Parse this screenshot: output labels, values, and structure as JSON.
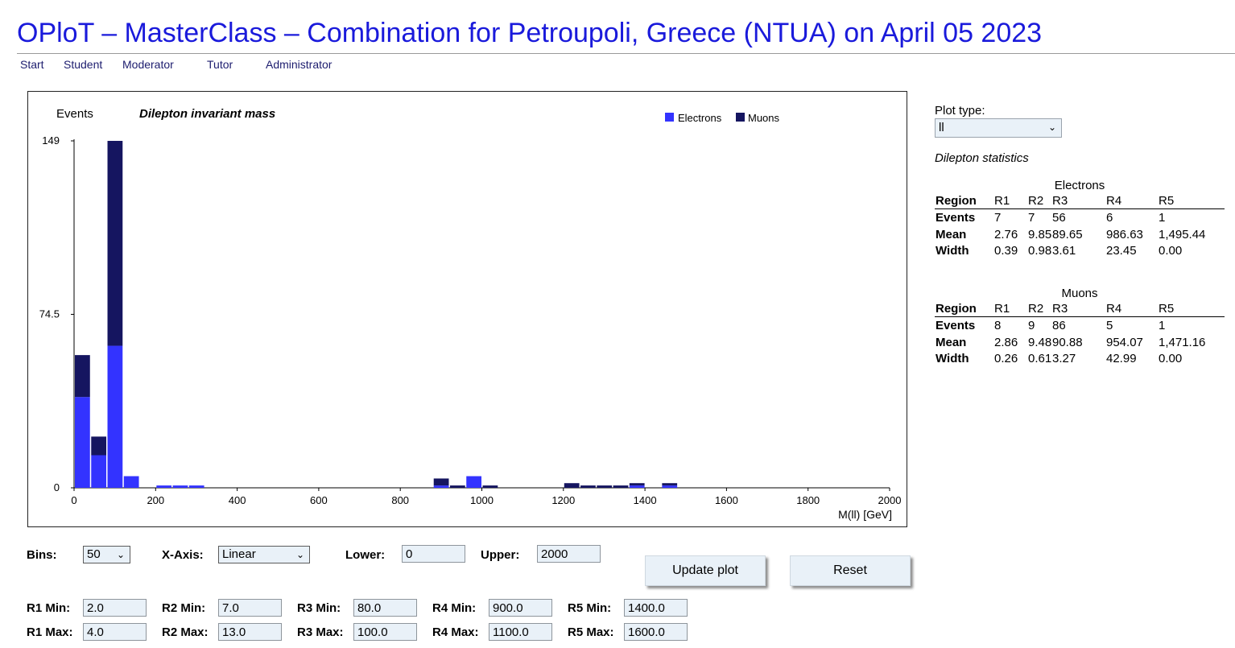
{
  "header": {
    "title": "OPloT – MasterClass – Combination for Petroupoli, Greece (NTUA) on April 05 2023",
    "nav": [
      "Start",
      "Student",
      "Moderator",
      "Tutor",
      "Administrator"
    ]
  },
  "chart_data": {
    "type": "bar",
    "stacked": true,
    "title": "Dilepton invariant mass",
    "ylabel": "Events",
    "xlabel": "M(ll) [GeV]",
    "xlim": [
      0,
      2000
    ],
    "ylim": [
      0,
      149
    ],
    "y_ticks": [
      "0",
      "74.5",
      "149"
    ],
    "x_ticks": [
      "0",
      "200",
      "400",
      "600",
      "800",
      "1000",
      "1200",
      "1400",
      "1600",
      "1800",
      "2000"
    ],
    "bin_width": 40,
    "bin_starts": [
      0,
      40,
      80,
      120,
      200,
      240,
      280,
      880,
      920,
      960,
      1000,
      1200,
      1240,
      1280,
      1320,
      1360,
      1440
    ],
    "series": [
      {
        "name": "Electrons",
        "color": "#3333ff",
        "values": [
          39,
          14,
          61,
          5,
          1,
          1,
          1,
          1,
          0,
          5,
          0,
          0,
          0,
          0,
          0,
          1,
          1
        ]
      },
      {
        "name": "Muons",
        "color": "#151560",
        "values": [
          18,
          8,
          88,
          0,
          0,
          0,
          0,
          3,
          1,
          0,
          1,
          2,
          1,
          1,
          1,
          1,
          1
        ]
      }
    ],
    "legend": "top-right"
  },
  "plot_type": {
    "label": "Plot type:",
    "value": "ll"
  },
  "stats": {
    "title": "Dilepton statistics",
    "columns": [
      "Region",
      "R1",
      "R2",
      "R3",
      "R4",
      "R5"
    ],
    "electrons": {
      "caption": "Electrons",
      "rows": [
        {
          "label": "Events",
          "values": [
            "7",
            "7",
            "56",
            "6",
            "1"
          ]
        },
        {
          "label": "Mean",
          "values": [
            "2.76",
            "9.85",
            "89.65",
            "986.63",
            "1,495.44"
          ]
        },
        {
          "label": "Width",
          "values": [
            "0.39",
            "0.98",
            "3.61",
            "23.45",
            "0.00"
          ]
        }
      ]
    },
    "muons": {
      "caption": "Muons",
      "rows": [
        {
          "label": "Events",
          "values": [
            "8",
            "9",
            "86",
            "5",
            "1"
          ]
        },
        {
          "label": "Mean",
          "values": [
            "2.86",
            "9.48",
            "90.88",
            "954.07",
            "1,471.16"
          ]
        },
        {
          "label": "Width",
          "values": [
            "0.26",
            "0.61",
            "3.27",
            "42.99",
            "0.00"
          ]
        }
      ]
    }
  },
  "controls": {
    "bins_label": "Bins:",
    "bins_value": "50",
    "xaxis_label": "X-Axis:",
    "xaxis_value": "Linear",
    "lower_label": "Lower:",
    "lower_value": "0",
    "upper_label": "Upper:",
    "upper_value": "2000",
    "update_button": "Update plot",
    "reset_button": "Reset",
    "ranges": [
      {
        "min_label": "R1 Min:",
        "min": "2.0",
        "max_label": "R1 Max:",
        "max": "4.0"
      },
      {
        "min_label": "R2 Min:",
        "min": "7.0",
        "max_label": "R2 Max:",
        "max": "13.0"
      },
      {
        "min_label": "R3 Min:",
        "min": "80.0",
        "max_label": "R3 Max:",
        "max": "100.0"
      },
      {
        "min_label": "R4 Min:",
        "min": "900.0",
        "max_label": "R4 Max:",
        "max": "1100.0"
      },
      {
        "min_label": "R5 Min:",
        "min": "1400.0",
        "max_label": "R5 Max:",
        "max": "1600.0"
      }
    ]
  }
}
